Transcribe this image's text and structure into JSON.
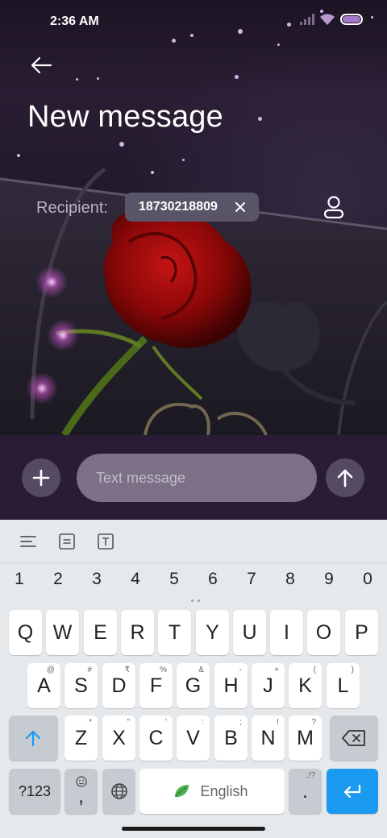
{
  "status_bar": {
    "time": "2:36 AM"
  },
  "header": {
    "title": "New message"
  },
  "recipient": {
    "label": "Recipient:",
    "chip_number": "18730218809",
    "chip_remove": "✕"
  },
  "compose": {
    "placeholder": "Text message"
  },
  "keyboard": {
    "numbers": [
      "1",
      "2",
      "3",
      "4",
      "5",
      "6",
      "7",
      "8",
      "9",
      "0"
    ],
    "row1": [
      {
        "k": "Q"
      },
      {
        "k": "W"
      },
      {
        "k": "E"
      },
      {
        "k": "R"
      },
      {
        "k": "T"
      },
      {
        "k": "Y"
      },
      {
        "k": "U"
      },
      {
        "k": "I"
      },
      {
        "k": "O"
      },
      {
        "k": "P"
      }
    ],
    "row2": [
      {
        "k": "A",
        "h": "@"
      },
      {
        "k": "S",
        "h": "#"
      },
      {
        "k": "D",
        "h": "₹"
      },
      {
        "k": "F",
        "h": "%"
      },
      {
        "k": "G",
        "h": "&"
      },
      {
        "k": "H",
        "h": "-"
      },
      {
        "k": "J",
        "h": "+"
      },
      {
        "k": "K",
        "h": "("
      },
      {
        "k": "L",
        "h": ")"
      }
    ],
    "row3": [
      {
        "k": "Z",
        "h": "*"
      },
      {
        "k": "X",
        "h": "\""
      },
      {
        "k": "C",
        "h": "'"
      },
      {
        "k": "V",
        "h": ":"
      },
      {
        "k": "B",
        "h": ";"
      },
      {
        "k": "N",
        "h": "!"
      },
      {
        "k": "M",
        "h": "?"
      }
    ],
    "symbols_label": "?123",
    "comma_label": ",",
    "space_label": "English",
    "period_label": ".",
    "period_hint": ",!?"
  },
  "colors": {
    "accent_blue": "#1a9af0",
    "compose_bg": "#2a1c35",
    "chip_bg": "#5a5468"
  }
}
